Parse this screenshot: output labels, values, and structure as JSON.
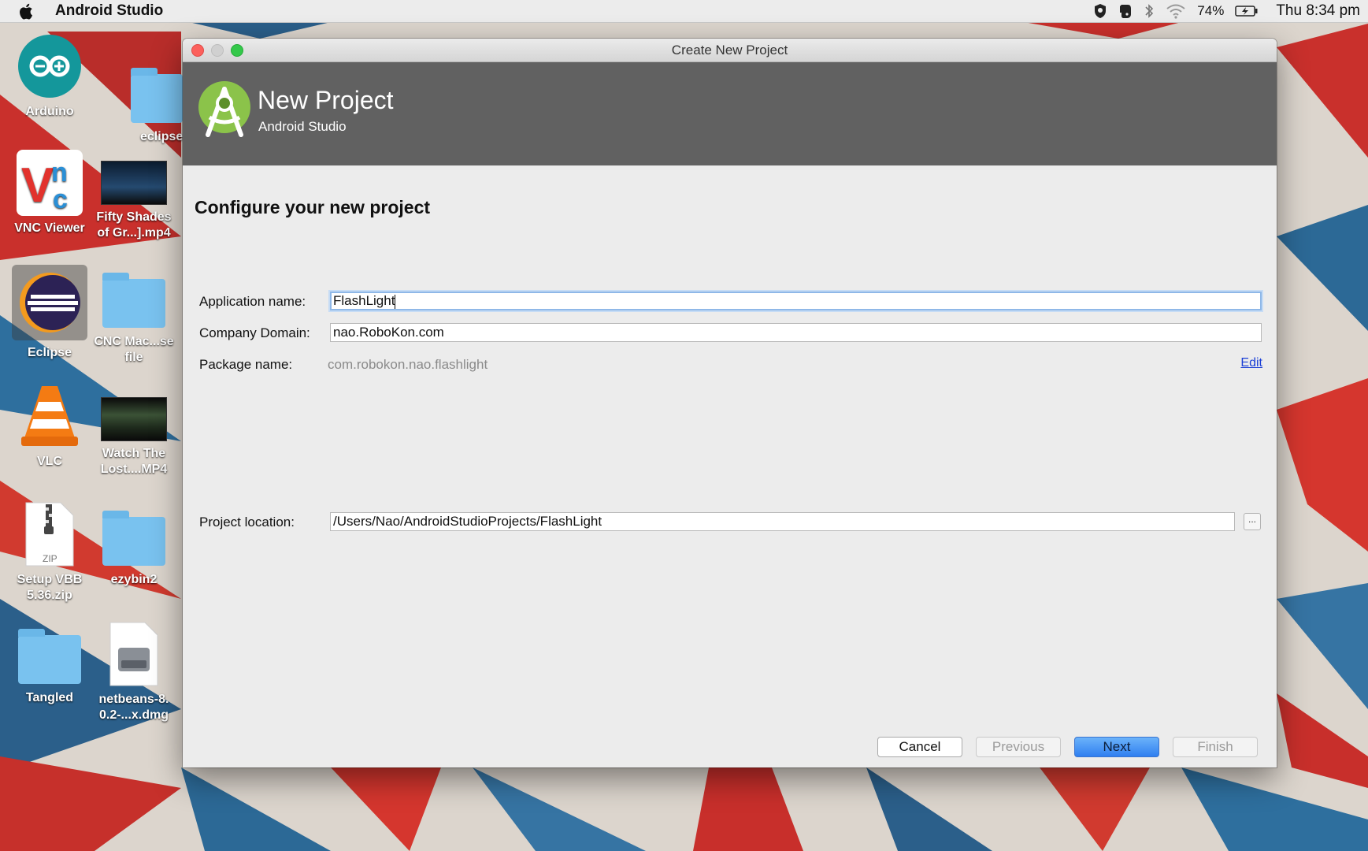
{
  "menubar": {
    "app_name": "Android Studio",
    "battery_percent": "74%",
    "clock": "Thu 8:34 pm"
  },
  "desktop": {
    "icons": [
      {
        "label": "Arduino"
      },
      {
        "label": "eclipse"
      },
      {
        "label": "VNC Viewer"
      },
      {
        "label": "Fifty Shades of Gr...].mp4"
      },
      {
        "label": "Eclipse"
      },
      {
        "label": "CNC Mac...se file"
      },
      {
        "label": "VLC"
      },
      {
        "label": "Watch The Lost....MP4"
      },
      {
        "label": "Setup VBB 5.36.zip"
      },
      {
        "label": "ezybin2"
      },
      {
        "label": "Tangled"
      },
      {
        "label": "netbeans-8. 0.2-...x.dmg"
      }
    ],
    "zip_badge": "ZIP"
  },
  "window": {
    "title": "Create New Project"
  },
  "banner": {
    "title": "New Project",
    "subtitle": "Android Studio"
  },
  "form": {
    "heading": "Configure your new project",
    "app_name_label": "Application name:",
    "app_name_value": "FlashLight",
    "company_domain_label": "Company Domain:",
    "company_domain_value": "nao.RoboKon.com",
    "package_name_label": "Package name:",
    "package_name_value": "com.robokon.nao.flashlight",
    "edit_link": "Edit",
    "project_location_label": "Project location:",
    "project_location_value": "/Users/Nao/AndroidStudioProjects/FlashLight",
    "browse_label": "..."
  },
  "buttons": {
    "cancel": "Cancel",
    "previous": "Previous",
    "next": "Next",
    "finish": "Finish"
  },
  "colors": {
    "banner_bg": "#616161",
    "primary_button": "#3d8bf2",
    "link": "#1a3fd6",
    "android_green": "#8bc34a"
  }
}
